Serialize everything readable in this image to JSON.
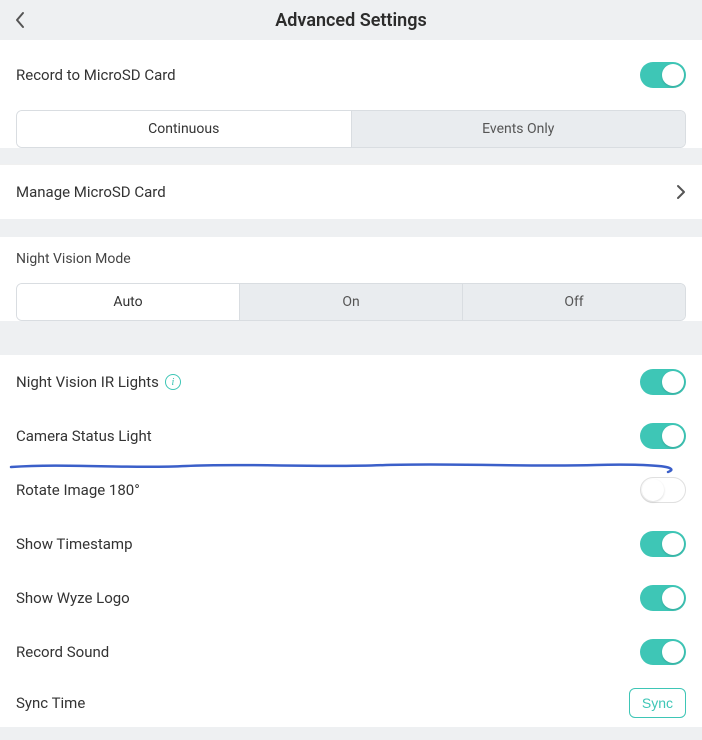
{
  "header": {
    "title": "Advanced Settings"
  },
  "record_sd": {
    "label": "Record to MicroSD Card",
    "on": true,
    "segments": {
      "continuous": "Continuous",
      "events_only": "Events Only",
      "active": "continuous"
    }
  },
  "manage_sd": {
    "label": "Manage MicroSD Card"
  },
  "night_vision": {
    "label": "Night Vision Mode",
    "segments": {
      "auto": "Auto",
      "on": "On",
      "off": "Off",
      "active": "auto"
    }
  },
  "ir_lights": {
    "label": "Night Vision IR Lights",
    "on": true
  },
  "status_light": {
    "label": "Camera Status Light",
    "on": true
  },
  "rotate": {
    "label": "Rotate Image 180°",
    "on": false
  },
  "timestamp": {
    "label": "Show Timestamp",
    "on": true
  },
  "wyze_logo": {
    "label": "Show Wyze Logo",
    "on": true
  },
  "record_sound": {
    "label": "Record Sound",
    "on": true
  },
  "sync_time": {
    "label": "Sync Time",
    "button": "Sync"
  }
}
